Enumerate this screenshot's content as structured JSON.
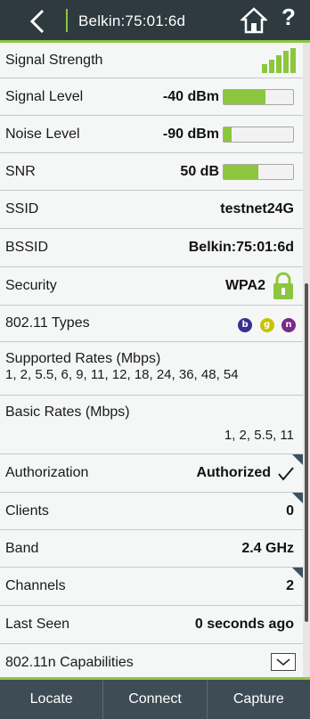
{
  "header": {
    "title": "Belkin:75:01:6d"
  },
  "rows": {
    "signal_strength": {
      "label": "Signal Strength"
    },
    "signal_level": {
      "label": "Signal Level",
      "value": "-40 dBm",
      "level": 0.6
    },
    "noise_level": {
      "label": "Noise Level",
      "value": "-90 dBm",
      "level": 0.12
    },
    "snr": {
      "label": "SNR",
      "value": "50 dB",
      "level": 0.5
    },
    "ssid": {
      "label": "SSID",
      "value": "testnet24G"
    },
    "bssid": {
      "label": "BSSID",
      "value": "Belkin:75:01:6d"
    },
    "security": {
      "label": "Security",
      "value": "WPA2"
    },
    "types": {
      "label": "802.11 Types",
      "badges": [
        "b",
        "g",
        "n"
      ]
    },
    "supported": {
      "label": "Supported Rates (Mbps)",
      "value": "1, 2, 5.5, 6, 9, 11, 12, 18, 24, 36, 48, 54"
    },
    "basic": {
      "label": "Basic Rates (Mbps)",
      "value": "1, 2, 5.5, 11"
    },
    "authorization": {
      "label": "Authorization",
      "value": "Authorized"
    },
    "clients": {
      "label": "Clients",
      "value": "0"
    },
    "band": {
      "label": "Band",
      "value": "2.4 GHz"
    },
    "channels": {
      "label": "Channels",
      "value": "2"
    },
    "last_seen": {
      "label": "Last Seen",
      "value": "0 seconds ago"
    },
    "capabilities": {
      "label": "802.11n Capabilities"
    }
  },
  "bottom_tabs": {
    "locate": "Locate",
    "connect": "Connect",
    "capture": "Capture"
  },
  "colors": {
    "accent": "#8cc63f",
    "header": "#2e3a3f",
    "badge_b": "#3a2f8f",
    "badge_g": "#c9c200",
    "badge_n": "#7a2a8a"
  }
}
